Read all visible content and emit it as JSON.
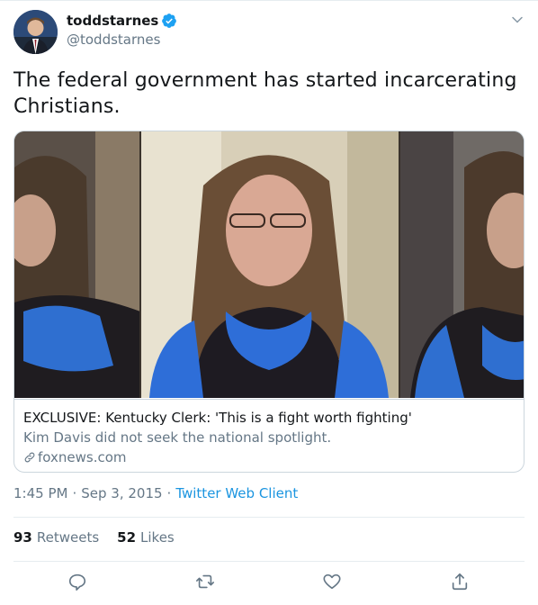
{
  "colors": {
    "text": "#14171a",
    "muted": "#657786",
    "link": "#1b95e0",
    "border": "#ccd6dd"
  },
  "author": {
    "display_name": "toddstarnes",
    "handle": "@toddstarnes",
    "verified": true,
    "avatar_icon": "user-avatar"
  },
  "tweet": {
    "text": "The federal government has started incarcerating Christians."
  },
  "card": {
    "image_icon": "news-photo",
    "title": "EXCLUSIVE: Kentucky Clerk: 'This is a fight worth fighting'",
    "description": "Kim Davis did not seek the national spotlight.",
    "domain": "foxnews.com",
    "link_icon": "link-icon"
  },
  "meta": {
    "time": "1:45 PM",
    "separator1": "·",
    "date": "Sep 3, 2015",
    "separator2": "·",
    "client": "Twitter Web Client"
  },
  "stats": {
    "retweets_count": "93",
    "retweets_label": "Retweets",
    "likes_count": "52",
    "likes_label": "Likes"
  },
  "actions": [
    "reply-icon",
    "retweet-icon",
    "like-icon",
    "share-icon"
  ]
}
